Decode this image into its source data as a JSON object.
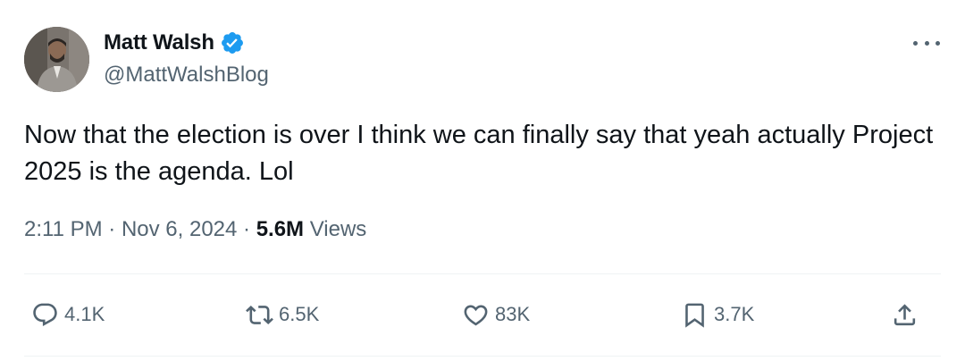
{
  "author": {
    "display_name": "Matt Walsh",
    "handle": "@MattWalshBlog",
    "verified": true
  },
  "tweet": {
    "text": "Now that the election is over I think we can finally say that yeah actually Project 2025 is the agenda. Lol"
  },
  "meta": {
    "time": "2:11 PM",
    "sep1": " · ",
    "date": "Nov 6, 2024",
    "sep2": " · ",
    "views_count": "5.6M",
    "views_label": " Views"
  },
  "actions": {
    "reply": {
      "icon": "reply-icon",
      "count": "4.1K"
    },
    "retweet": {
      "icon": "retweet-icon",
      "count": "6.5K"
    },
    "like": {
      "icon": "heart-icon",
      "count": "83K"
    },
    "bookmark": {
      "icon": "bookmark-icon",
      "count": "3.7K"
    },
    "share": {
      "icon": "share-icon"
    }
  },
  "colors": {
    "text_primary": "#0f1419",
    "text_secondary": "#536471",
    "verified_blue": "#1d9bf0",
    "divider": "#eff3f4"
  }
}
